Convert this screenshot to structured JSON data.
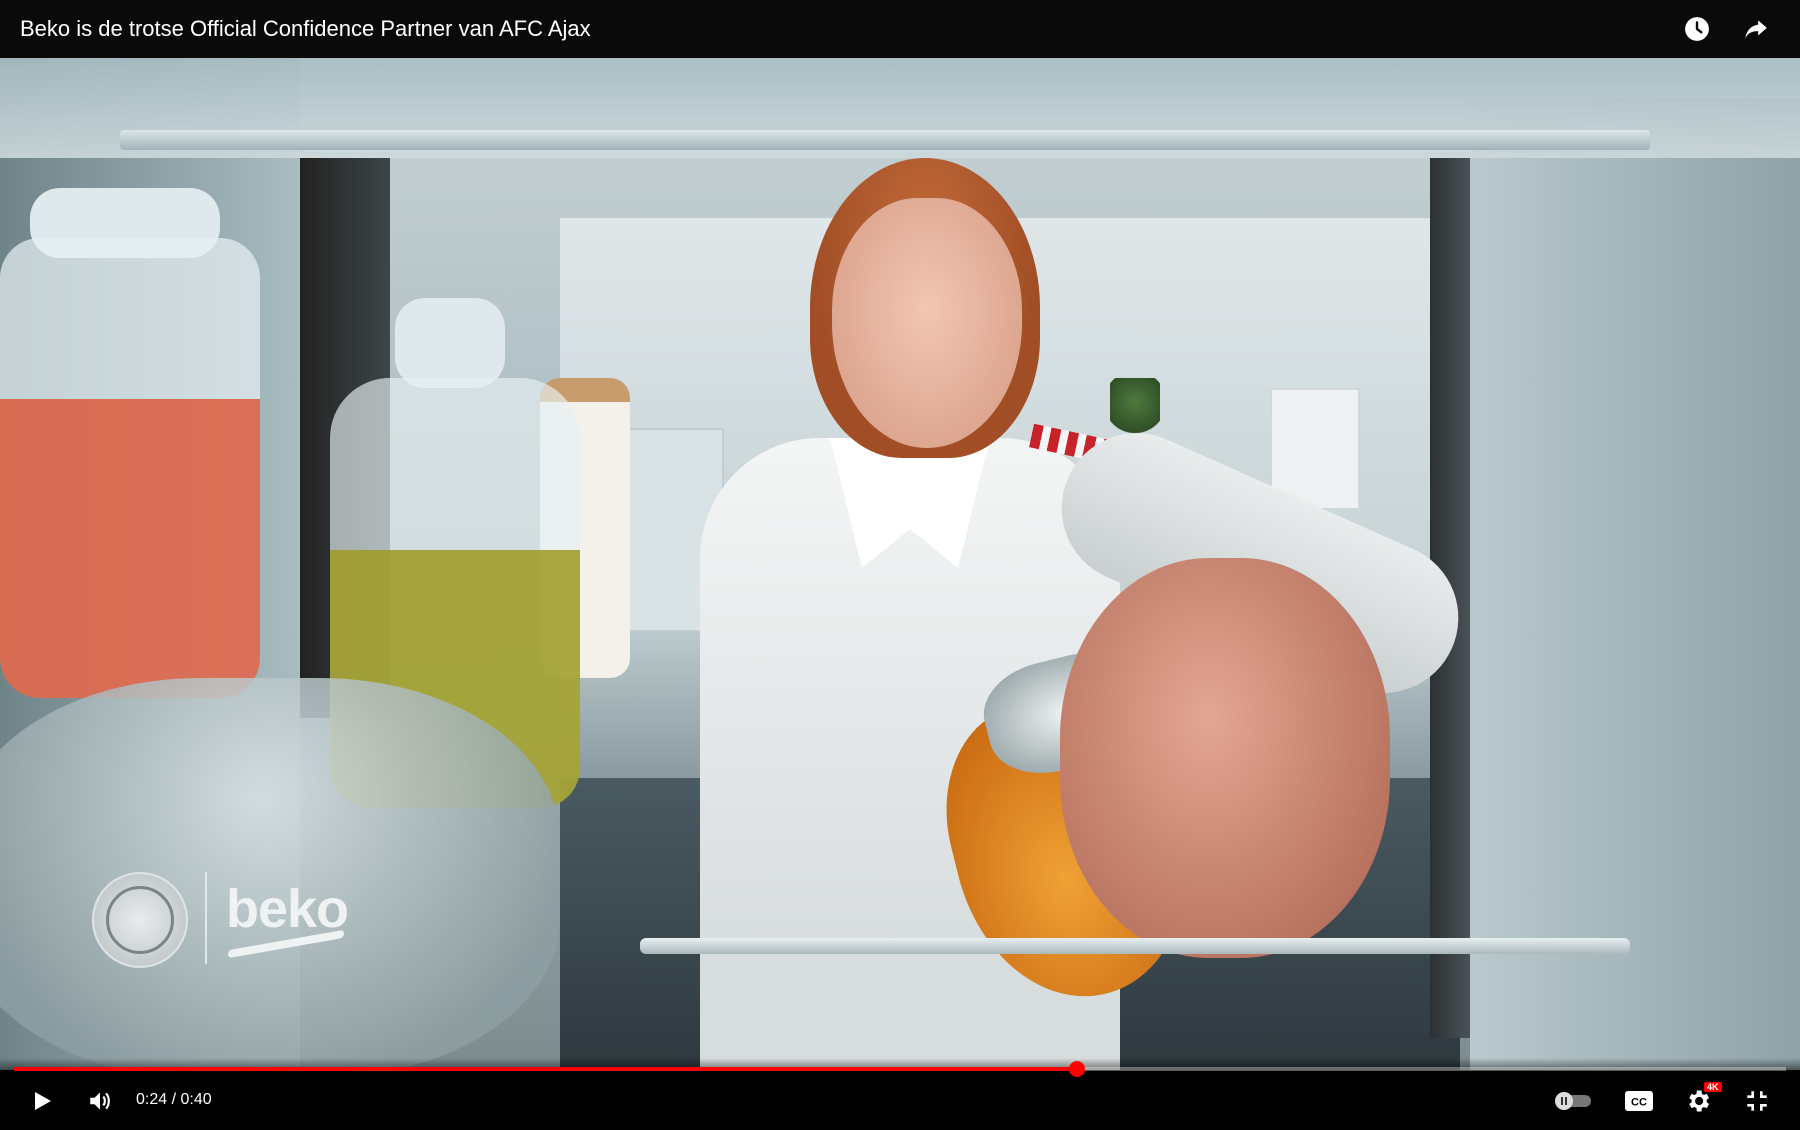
{
  "header": {
    "title": "Beko is de trotse Official Confidence Partner van AFC Ajax",
    "icons": [
      "clock-icon",
      "share-icon"
    ]
  },
  "video": {
    "brand_text": "beko",
    "crest": "ajax-crest"
  },
  "player": {
    "time_display": "0:24 / 0:40",
    "progress_fraction": 0.6,
    "quality_badge": "4K",
    "icons": [
      "play-icon",
      "volume-icon",
      "autoplay-toggle-icon",
      "cc-icon",
      "settings-icon",
      "exit-fullscreen-icon"
    ]
  },
  "colors": {
    "progress": "#ff0000",
    "background": "#000000",
    "text": "#ffffff"
  }
}
